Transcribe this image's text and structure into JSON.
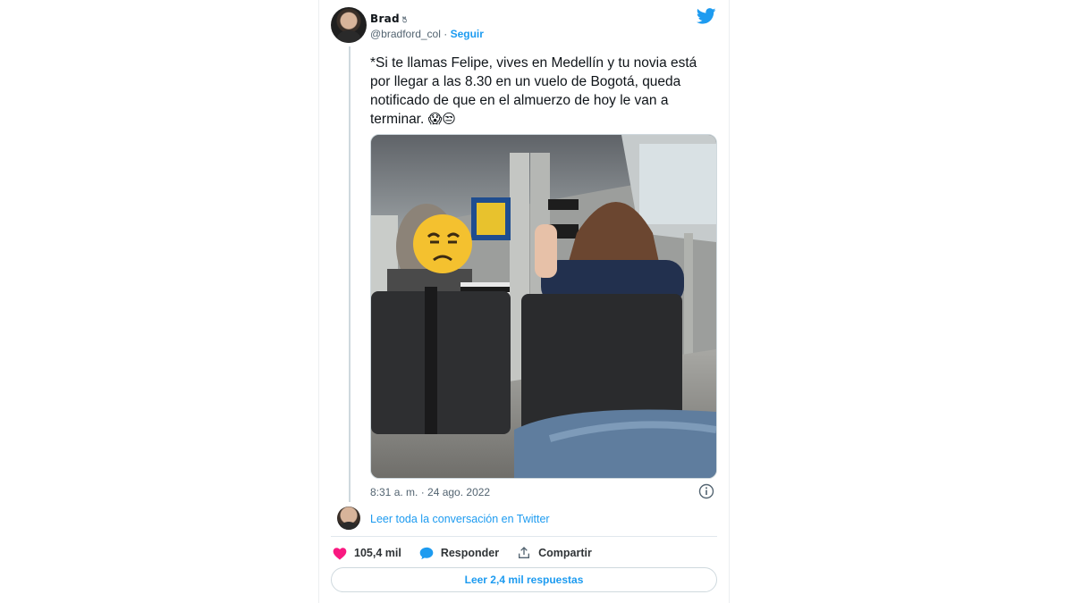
{
  "tweet": {
    "author_name": "Brad",
    "verified_glyph": "🖔",
    "handle": "@bradford_col",
    "separator": " · ",
    "follow_label": "Seguir",
    "text": "*Si te llamas Felipe, vives en Medellín y tu novia está por llegar a las 8.30 en un vuelo de Bogotá, queda notificado de que en el almuerzo de hoy le van a terminar.",
    "emojis": "😱😒",
    "timestamp": "8:31 a. m. · 24 ago. 2022",
    "read_conversation": "Leer toda la conversación en Twitter",
    "likes_count": "105,4 mil",
    "reply_label": "Responder",
    "share_label": "Compartir",
    "read_replies": "Leer 2,4 mil respuestas"
  },
  "photo": {
    "description_icon": "airport-waiting-area-photo"
  },
  "colors": {
    "twitter_blue": "#1d9bf0",
    "like_pink": "#f91880",
    "text_dark": "#0f1419",
    "text_gray": "#536471"
  }
}
